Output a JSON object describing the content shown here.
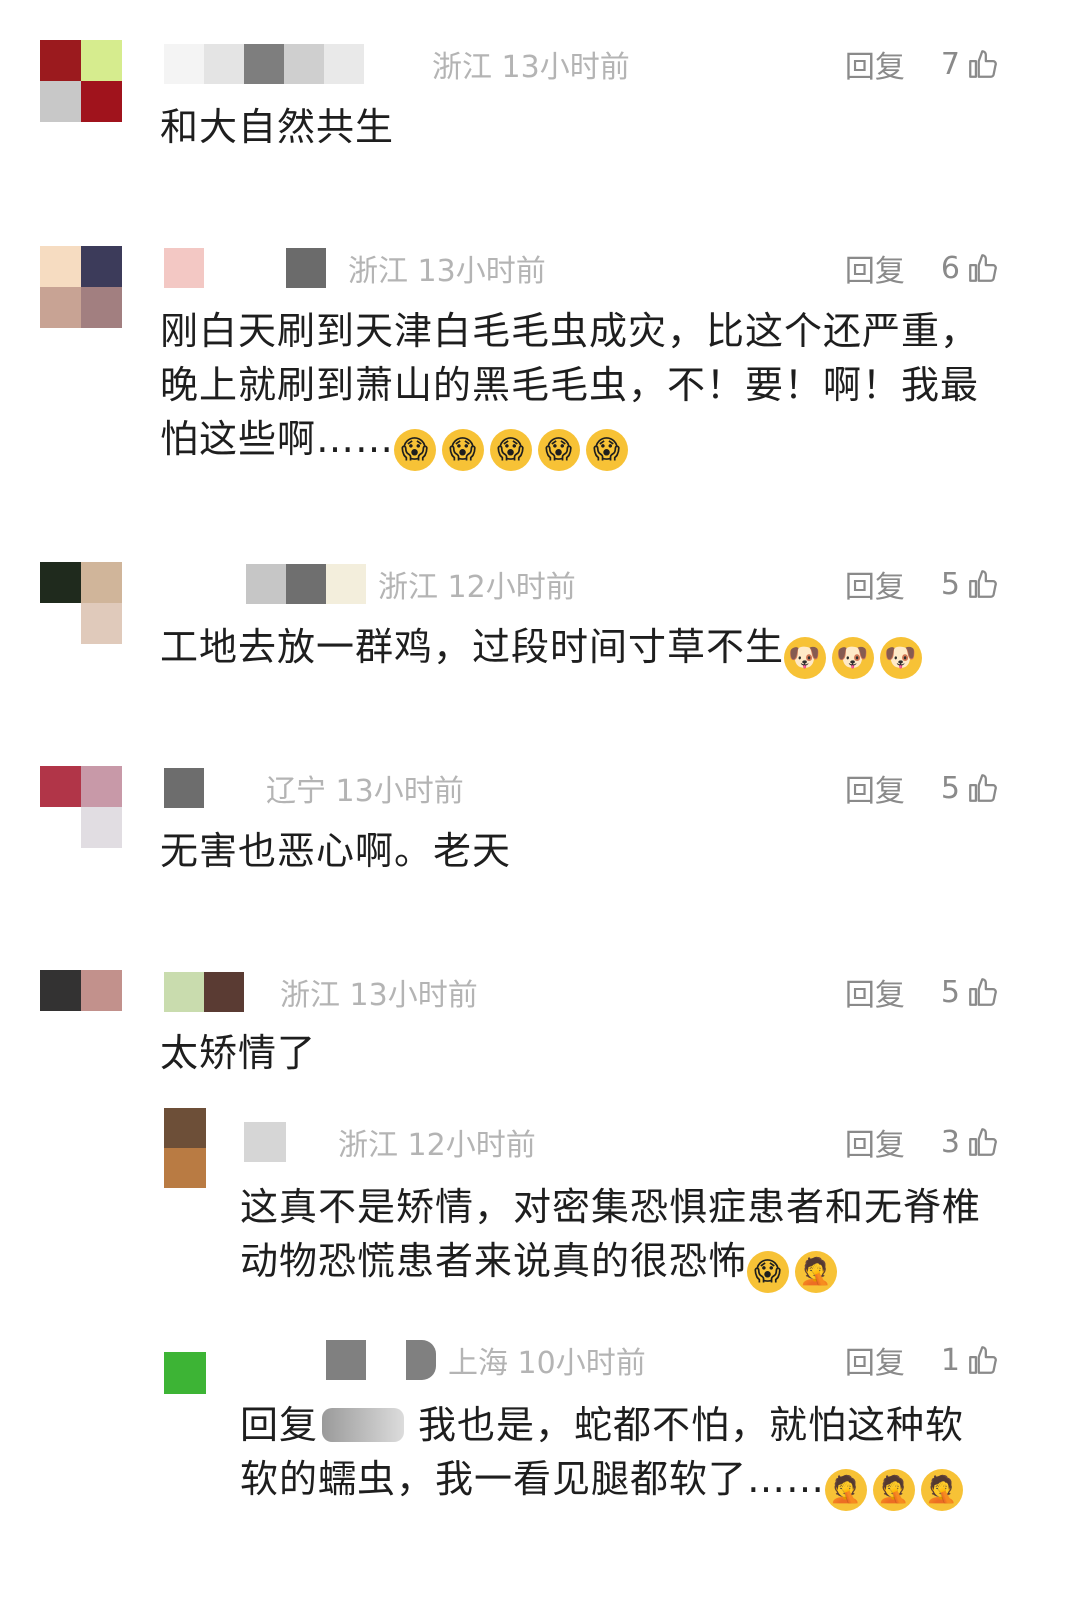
{
  "comments": [
    {
      "location": "浙江",
      "time": "13小时前",
      "reply_label": "回复",
      "likes": "7",
      "text": "和大自然共生",
      "avatar_colors": [
        "#9b1a1e",
        "#d6ec8e",
        "#c8c8c8",
        "#a0131c"
      ],
      "name_blur": [
        "#e4e4e4",
        "#7e7e7e",
        "#cfcfcf"
      ]
    },
    {
      "location": "浙江",
      "time": "13小时前",
      "reply_label": "回复",
      "likes": "6",
      "lines": [
        "刚白天刷到天津白毛毛虫成灾，比这个还严重，",
        "晚上就刷到萧山的黑毛毛虫，不！要！啊！我最",
        "怕这些啊……"
      ],
      "emoji_count": 5,
      "emoji": "😱",
      "avatar_colors": [
        "#f6dcc1",
        "#3c3b5a",
        "#c8a394",
        "#a27f80"
      ],
      "name_blur": [
        "#f3c8c4",
        "#ffffff",
        "#6b6b6b"
      ]
    },
    {
      "location": "浙江",
      "time": "12小时前",
      "reply_label": "回复",
      "likes": "5",
      "text": "工地去放一群鸡，过段时间寸草不生",
      "emoji_count": 3,
      "emoji": "🐶",
      "avatar_colors": [
        "#1f2a1d",
        "#d0b59a",
        "#ffffff",
        "#e0cabb"
      ],
      "name_blur": [
        "#c6c6c6",
        "#6f6f6f",
        "#f3eedc"
      ]
    },
    {
      "location": "辽宁",
      "time": "13小时前",
      "reply_label": "回复",
      "likes": "5",
      "text": "无害也恶心啊。老天",
      "avatar_colors": [
        "#b13548",
        "#c899a8",
        "#ffffff",
        "#e1dde2"
      ],
      "name_blur": [
        "#6d6d6d",
        "#ffffff",
        "#ffffff"
      ]
    },
    {
      "location": "浙江",
      "time": "13小时前",
      "reply_label": "回复",
      "likes": "5",
      "text": "太矫情了",
      "avatar_colors": [
        "#333232",
        "#c2918c",
        "#ffffff",
        "#ffffff"
      ],
      "name_blur": [
        "#c9dcae",
        "#5a3b33",
        "#ffffff"
      ]
    },
    {
      "location": "浙江",
      "time": "12小时前",
      "reply_label": "回复",
      "likes": "3",
      "lines": [
        "这真不是矫情，对密集恐惧症患者和无脊椎",
        "动物恐慌患者来说真的很恐怖"
      ],
      "emojis": [
        "😱",
        "🤦"
      ],
      "avatar_colors": [
        "#6d4f38",
        "#b97b43"
      ],
      "name_blur": [
        "#d6d6d6",
        "#ffffff",
        "#ffffff"
      ]
    },
    {
      "location": "上海",
      "time": "10小时前",
      "reply_label": "回复",
      "likes": "1",
      "lines": [
        "回复",
        "我也是，蛇都不怕，就怕这种软",
        "软的蠕虫，我一看见腿都软了……"
      ],
      "emoji_count": 3,
      "emoji": "🤦",
      "avatar_colors": [
        "#3db435"
      ],
      "name_blur": [
        "#ffffff",
        "#808080",
        "#808080"
      ]
    }
  ]
}
